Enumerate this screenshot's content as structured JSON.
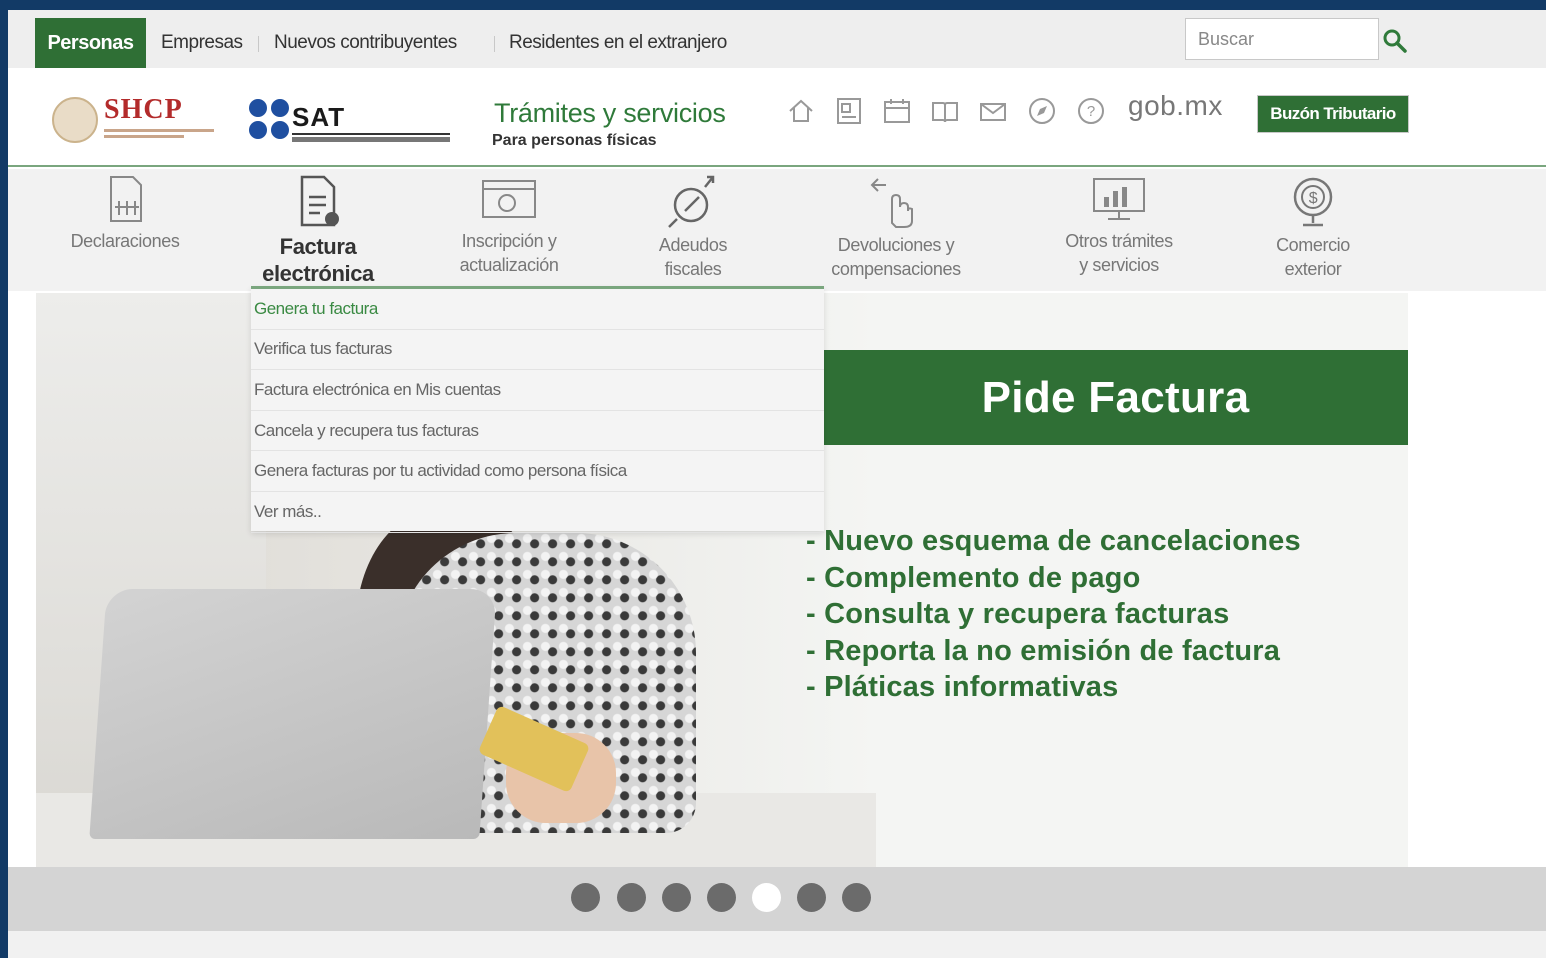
{
  "topnav": {
    "active_tab": "Personas",
    "links": [
      "Empresas",
      "Nuevos contribuyentes",
      "Residentes en el extranjero"
    ],
    "search_placeholder": "Buscar"
  },
  "header": {
    "shcp": "SHCP",
    "sat": "SAT",
    "tramites_title": "Trámites y servicios",
    "tramites_subtitle": "Para personas físicas",
    "gobmx": "gob.mx",
    "buzon": "Buzón Tributario"
  },
  "nav": {
    "items": [
      {
        "label": "Declaraciones",
        "icon": "declaraciones-icon"
      },
      {
        "label": "Factura\nelectrónica",
        "icon": "factura-icon"
      },
      {
        "label": "Inscripción y\nactualización",
        "icon": "inscripcion-icon"
      },
      {
        "label": "Adeudos\nfiscales",
        "icon": "adeudos-icon"
      },
      {
        "label": "Devoluciones y\ncompensaciones",
        "icon": "devoluciones-icon"
      },
      {
        "label": "Otros trámites\ny servicios",
        "icon": "otros-tramites-icon"
      },
      {
        "label": "Comercio\nexterior",
        "icon": "comercio-icon"
      }
    ]
  },
  "dropdown": {
    "items": [
      "Genera tu factura",
      "Verifica tus facturas",
      "Factura electrónica en Mis cuentas",
      "Cancela y recupera tus facturas",
      "Genera facturas por tu actividad como persona física",
      "Ver más.."
    ]
  },
  "hero": {
    "title": "Pide Factura",
    "bullets": [
      "- Nuevo esquema de cancelaciones",
      "- Complemento de pago",
      "- Consulta y recupera facturas",
      "- Reporta la no emisión de factura",
      "- Pláticas informativas"
    ]
  },
  "carousel": {
    "count": 7,
    "active_index": 4
  },
  "colors": {
    "brand_green": "#2f6f35",
    "accent_green_text": "#2f7a3a",
    "frame_blue": "#123a66",
    "shcp_red": "#b32b2b"
  }
}
